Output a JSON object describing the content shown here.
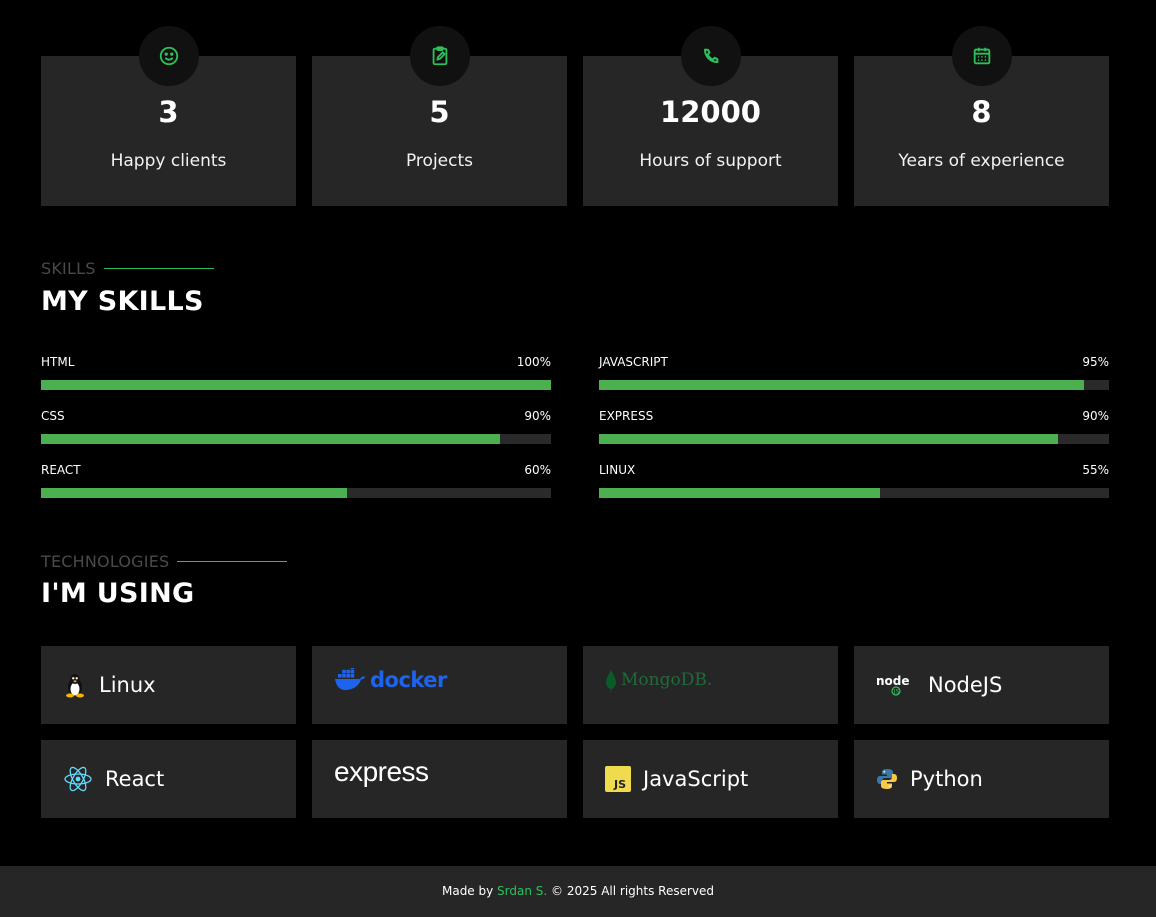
{
  "stats": [
    {
      "number": "3",
      "label": "Happy clients",
      "icon": "smile-icon"
    },
    {
      "number": "5",
      "label": "Projects",
      "icon": "clipboard-edit-icon"
    },
    {
      "number": "12000",
      "label": "Hours of support",
      "icon": "phone-icon"
    },
    {
      "number": "8",
      "label": "Years of experience",
      "icon": "calendar-icon"
    }
  ],
  "skills_section": {
    "subtitle": "SKILLS",
    "title": "MY SKILLS",
    "left": [
      {
        "name": "HTML",
        "percent_label": "100%",
        "value": 100
      },
      {
        "name": "CSS",
        "percent_label": "90%",
        "value": 90
      },
      {
        "name": "REACT",
        "percent_label": "60%",
        "value": 60
      }
    ],
    "right": [
      {
        "name": "JAVASCRIPT",
        "percent_label": "95%",
        "value": 95
      },
      {
        "name": "EXPRESS",
        "percent_label": "90%",
        "value": 90
      },
      {
        "name": "LINUX",
        "percent_label": "55%",
        "value": 55
      }
    ]
  },
  "tech_section": {
    "subtitle": "TECHNOLOGIES",
    "title": "I'M USING",
    "items": [
      {
        "name": "Linux",
        "icon": "tux-icon"
      },
      {
        "name": "docker",
        "icon": "docker-logo"
      },
      {
        "name": "MongoDB.",
        "icon": "mongodb-logo"
      },
      {
        "name": "NodeJS",
        "icon": "node-logo"
      },
      {
        "name": "React",
        "icon": "react-icon"
      },
      {
        "name": "express",
        "icon": "express-logo"
      },
      {
        "name": "JavaScript",
        "icon": "js-icon"
      },
      {
        "name": "Python",
        "icon": "python-icon"
      }
    ]
  },
  "footer": {
    "prefix": "Made by ",
    "author": "Srdan S.",
    "suffix": " © 2025 All rights Reserved"
  },
  "colors": {
    "accent": "#2fbf5a",
    "bar_fill": "#4caf50",
    "card_bg": "#262626",
    "page_bg": "#000000"
  }
}
